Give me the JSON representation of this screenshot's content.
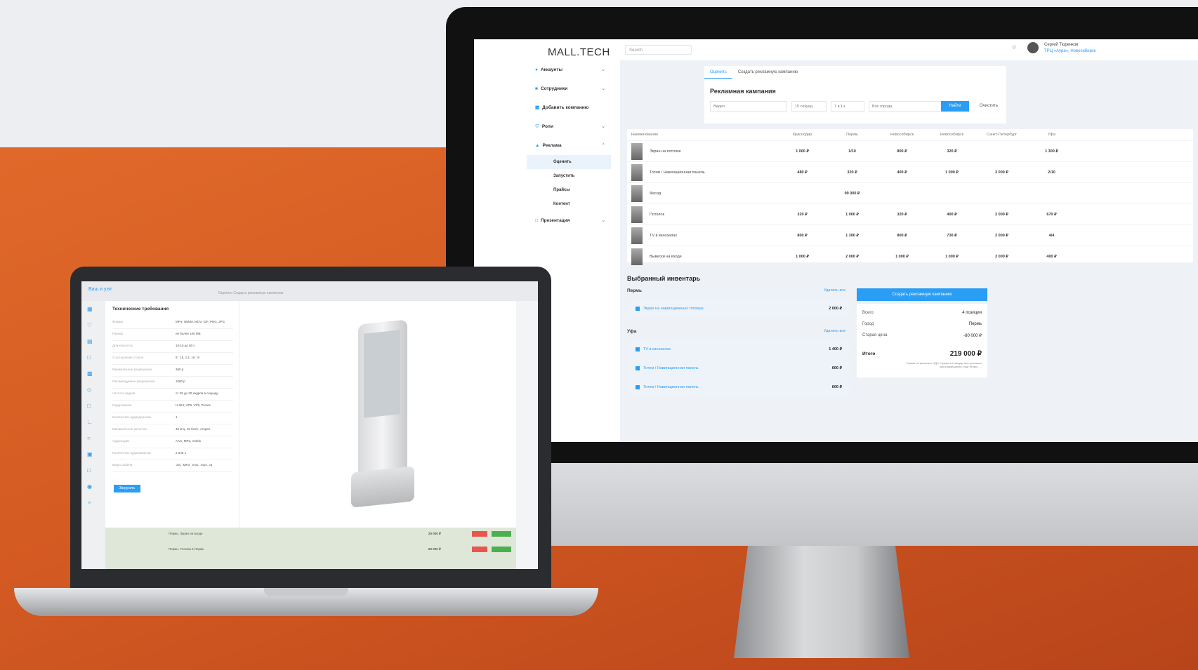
{
  "app": {
    "logo": "MALL.TECH",
    "search_placeholder": "Search",
    "user_name": "Сергей Тюренков",
    "user_sub": "ТРЦ «Аура», Новосибирск"
  },
  "sidebar": {
    "items": [
      {
        "label": "Аккаунты",
        "icon": "users-icon"
      },
      {
        "label": "Сотрудники",
        "icon": "staff-icon"
      },
      {
        "label": "Добавить компанию",
        "icon": "building-icon"
      },
      {
        "label": "Роли",
        "icon": "shield-icon"
      },
      {
        "label": "Реклама",
        "icon": "megaphone-icon"
      }
    ],
    "subitems": [
      "Оценить",
      "Запустить",
      "Прайсы",
      "Контент"
    ],
    "last_item": {
      "label": "Презентация",
      "icon": "presentation-icon"
    }
  },
  "campaign": {
    "tabs": [
      "Оценить",
      "Создать рекламную кампанию"
    ],
    "title": "Рекламная кампания",
    "filters": [
      "Видео",
      "15 секунд",
      "7 в 1ч",
      "Все города"
    ],
    "find_label": "Найти",
    "clear_label": "Очистить"
  },
  "table": {
    "headers": [
      "Наименование",
      "Краснодар",
      "Пермь",
      "Новосибирск",
      "Новосибирск",
      "Санкт-Петербург",
      "Уфа"
    ],
    "rows": [
      {
        "name": "Экран на потолке",
        "cells": [
          "1 000 ₽",
          "1/10",
          "800 ₽",
          "320 ₽",
          "",
          "1 300 ₽"
        ]
      },
      {
        "name": "Тотем / Навигационная панель",
        "cells": [
          "480 ₽",
          "320 ₽",
          "400 ₽",
          "1 000 ₽",
          "2 000 ₽",
          "2/10"
        ]
      },
      {
        "name": "Фасад",
        "cells": [
          "",
          "99 000 ₽",
          "",
          "",
          "",
          ""
        ]
      },
      {
        "name": "Потолок",
        "cells": [
          "320 ₽",
          "1 000 ₽",
          "320 ₽",
          "400 ₽",
          "2 000 ₽",
          "670 ₽"
        ]
      },
      {
        "name": "ТV в кинозалах",
        "cells": [
          "800 ₽",
          "1 300 ₽",
          "800 ₽",
          "730 ₽",
          "2 000 ₽",
          "4/4"
        ]
      },
      {
        "name": "Вывески на входе",
        "cells": [
          "1 000 ₽",
          "2 000 ₽",
          "1 000 ₽",
          "1 000 ₽",
          "2 000 ₽",
          "400 ₽"
        ]
      }
    ]
  },
  "selected": {
    "title": "Выбранный инвентарь",
    "delete_all": "Удалить все",
    "groups": [
      {
        "city": "Пермь",
        "items": [
          {
            "label": "Экран на навигационных тотемах",
            "price": "2 000 ₽"
          }
        ]
      },
      {
        "city": "Уфа",
        "items": [
          {
            "label": "TV в кинозалах",
            "price": "1 400 ₽"
          },
          {
            "label": "Тотем / Навигационная панель",
            "price": "600 ₽"
          },
          {
            "label": "Тотем / Навигационная панель",
            "price": "600 ₽"
          }
        ]
      }
    ],
    "create_label": "Создать рекламную кампанию",
    "summary": [
      {
        "k": "Всего",
        "v": "4 позиции"
      },
      {
        "k": "Город",
        "v": "Пермь"
      },
      {
        "k": "Старая цена",
        "v": "-80 000 ₽"
      }
    ],
    "total_label": "Итого",
    "total_value": "219 000 ₽",
    "note": "Сумма не включает НДС. Сумма в стандартных условиях для размещения, ещё не вкл. ..."
  },
  "laptop": {
    "back_label": "Ваш и у.вт",
    "tabs": "Оценить   Создать рекламную кампанию",
    "spec_title": "Технические требования",
    "spec_rows": [
      {
        "k": "Формат",
        "v": "MP4, WebM, MOV, GIF, PNG, JPG"
      },
      {
        "k": "Размер",
        "v": "не более 100 МБ"
      },
      {
        "k": "Длительность",
        "v": "10-15 до 60 с"
      },
      {
        "k": "Соотношение сторон",
        "v": "9 : 16, 1:1, 16 : 9"
      },
      {
        "k": "Минимальное разрешение",
        "v": "360 р"
      },
      {
        "k": "Рекомендуемое разрешение",
        "v": "1080 р"
      },
      {
        "k": "Частота кадров",
        "v": "от 25 до 30 кадров в секунду"
      },
      {
        "k": "Кодирование",
        "v": "H.264, VP8, VP9, Prores"
      },
      {
        "k": "Количество аудиодорожек",
        "v": "1"
      },
      {
        "k": "Минимальное качество",
        "v": "48 кГц, 16 бит/с, стерео"
      },
      {
        "k": "Аудиокодек",
        "v": "AAC, MP3, Vorbis"
      },
      {
        "k": "Количество аудиоканалов",
        "v": "2 или 1"
      },
      {
        "k": "Видео файла",
        "v": ".avi, .MKV, .mov, .mp4, .qt"
      }
    ],
    "upload_label": "Загрузить",
    "bottom_rows": [
      {
        "label": "Пермь, Экран на входе",
        "price": "20 000 ₽"
      },
      {
        "label": "Пермь, Тотемы в Пермь",
        "price": "60 000 ₽"
      }
    ]
  }
}
